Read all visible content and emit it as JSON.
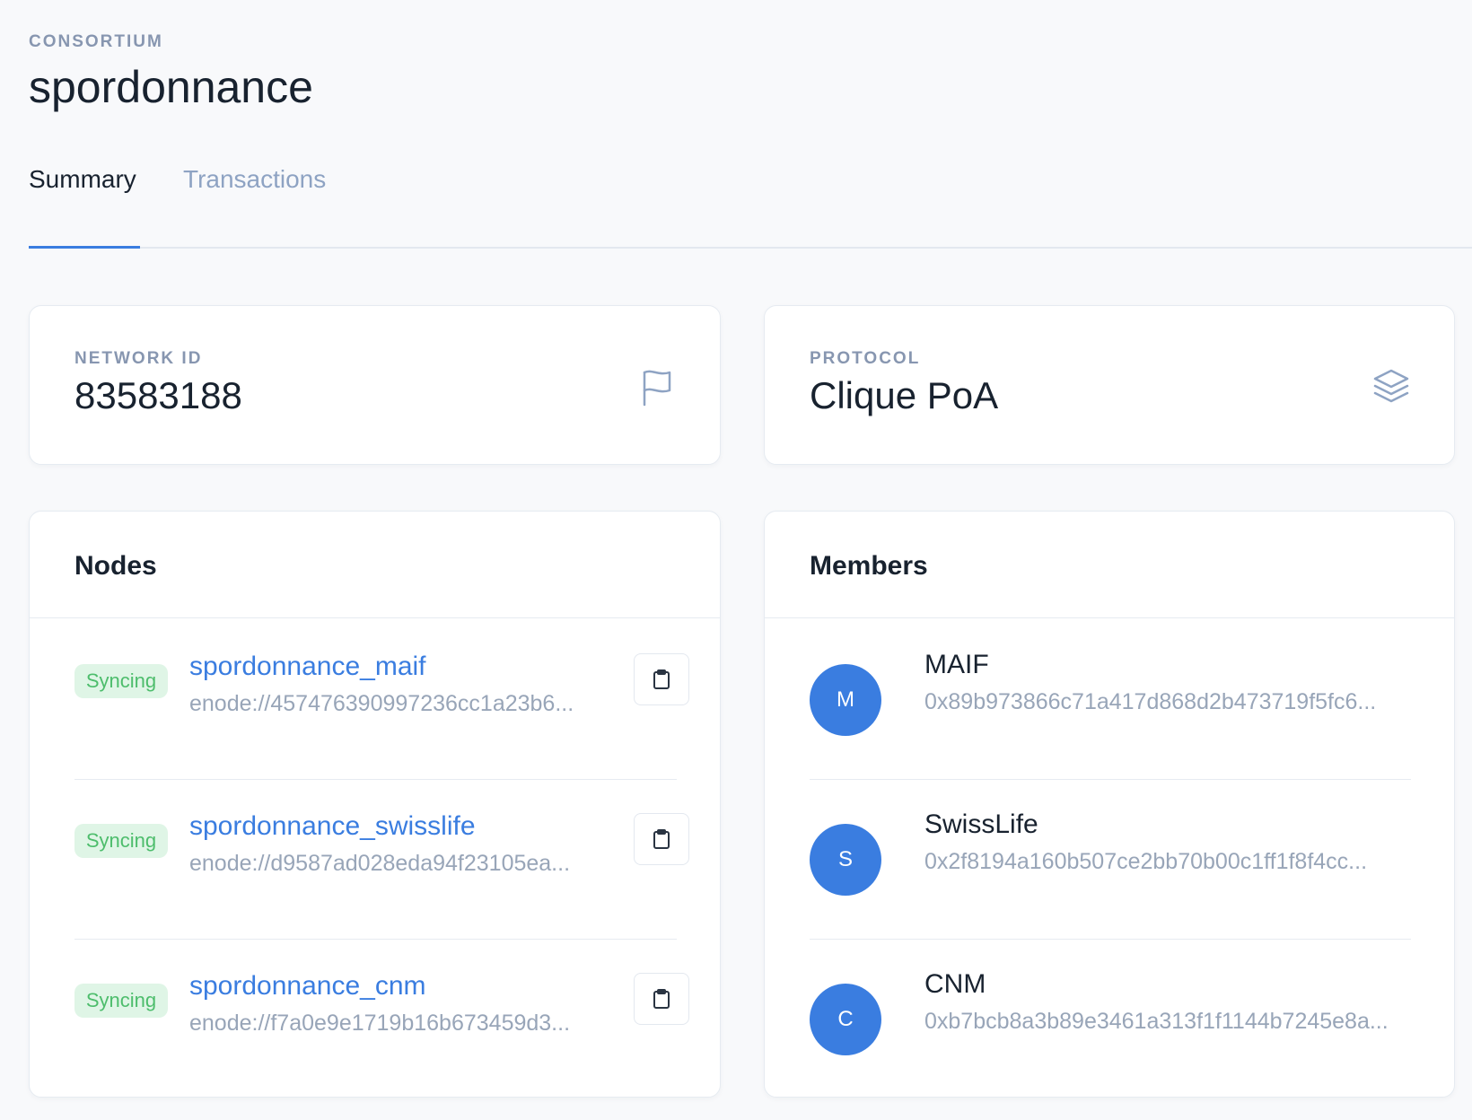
{
  "header": {
    "eyebrow": "CONSORTIUM",
    "title": "spordonnance"
  },
  "tabs": [
    {
      "label": "Summary",
      "active": true
    },
    {
      "label": "Transactions",
      "active": false
    }
  ],
  "stats": {
    "network": {
      "label": "NETWORK ID",
      "value": "83583188",
      "icon": "flag-icon"
    },
    "protocol": {
      "label": "PROTOCOL",
      "value": "Clique PoA",
      "icon": "layers-icon"
    }
  },
  "nodes": {
    "title": "Nodes",
    "items": [
      {
        "status": "Syncing",
        "name": "spordonnance_maif",
        "enode": "enode://457476390997236cc1a23b6..."
      },
      {
        "status": "Syncing",
        "name": "spordonnance_swisslife",
        "enode": "enode://d9587ad028eda94f23105ea..."
      },
      {
        "status": "Syncing",
        "name": "spordonnance_cnm",
        "enode": "enode://f7a0e9e1719b16b673459d3..."
      }
    ]
  },
  "members": {
    "title": "Members",
    "items": [
      {
        "initial": "M",
        "name": "MAIF",
        "address": "0x89b973866c71a417d868d2b473719f5fc6..."
      },
      {
        "initial": "S",
        "name": "SwissLife",
        "address": "0x2f8194a160b507ce2bb70b00c1ff1f8f4cc..."
      },
      {
        "initial": "C",
        "name": "CNM",
        "address": "0xb7bcb8a3b89e3461a313f1f1144b7245e8a..."
      }
    ]
  },
  "colors": {
    "accent": "#3a7de0",
    "syncing_bg": "#dff5e6",
    "syncing_text": "#4dbd6c",
    "muted": "#8796b0"
  }
}
